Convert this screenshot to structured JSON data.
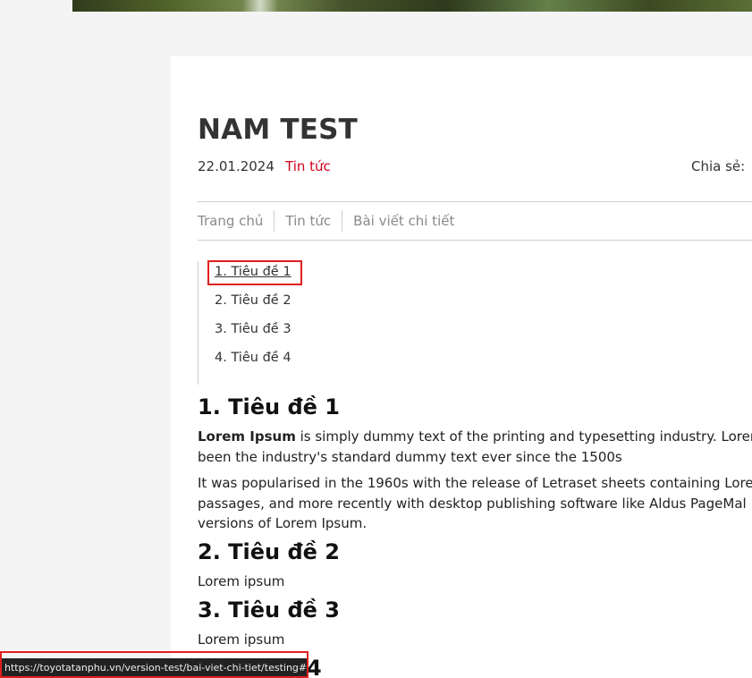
{
  "article": {
    "title": "NAM TEST",
    "date": "22.01.2024",
    "category": "Tin tức",
    "share_label": "Chia sẻ:"
  },
  "breadcrumb": [
    "Trang chủ",
    "Tin tức",
    "Bài viết chi tiết"
  ],
  "toc": [
    "1. Tiêu đề 1",
    "2. Tiêu đề 2",
    "3. Tiêu đề 3",
    "4. Tiêu đề 4"
  ],
  "sections": {
    "s1_heading": "1. Tiêu đề 1",
    "s1_p1_bold": "Lorem Ipsum",
    "s1_p1_line1": " is simply dummy text of the printing and typesetting industry. Lorem",
    "s1_p1_line2": "been the industry's standard dummy text ever since the 1500s",
    "s1_p2_line1": "It was popularised in the 1960s with the release of Letraset sheets containing Lore",
    "s1_p2_line2": "passages, and more recently with desktop publishing software like Aldus PageMal",
    "s1_p2_line3": "versions of Lorem Ipsum.",
    "s2_heading": "2. Tiêu đề 2",
    "s2_text": "Lorem ipsum",
    "s3_heading": "3. Tiêu đề 3",
    "s3_text": "Lorem ipsum",
    "s4_heading_partial": "4"
  },
  "status_url": "https://toyotatanphu.vn/version-test/bai-viet-chi-tiet/testing#",
  "colors": {
    "accent": "#d0021b",
    "highlight": "#e01e1e"
  }
}
